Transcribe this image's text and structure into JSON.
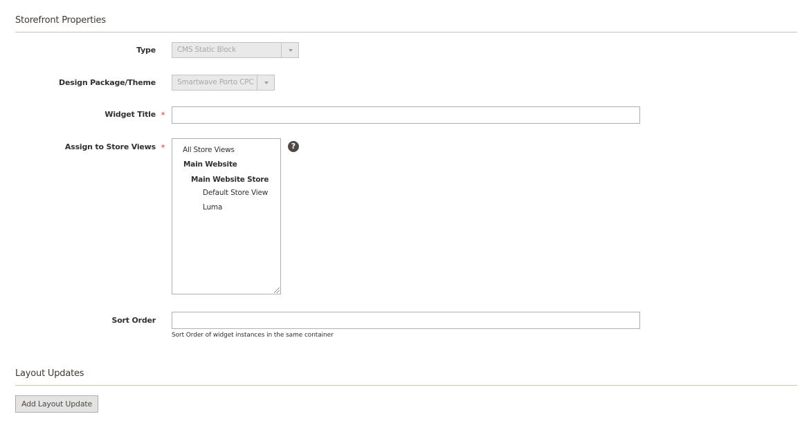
{
  "storefront": {
    "section_title": "Storefront Properties",
    "type": {
      "label": "Type",
      "value": "CMS Static Block"
    },
    "design": {
      "label": "Design Package/Theme",
      "value": "Smartwave Porto CPC"
    },
    "widget_title": {
      "label": "Widget Title",
      "required_mark": "*",
      "value": ""
    },
    "store_views": {
      "label": "Assign to Store Views",
      "required_mark": "*",
      "help_icon": "question-circle-icon",
      "help_glyph": "?",
      "options": {
        "all": "All Store Views",
        "website": "Main Website",
        "store": "Main Website Store",
        "default_view": "Default Store View",
        "luma": "Luma"
      }
    },
    "sort_order": {
      "label": "Sort Order",
      "value": "",
      "note": "Sort Order of widget instances in the same container"
    }
  },
  "layout_updates": {
    "section_title": "Layout Updates",
    "add_button_label": "Add Layout Update"
  }
}
